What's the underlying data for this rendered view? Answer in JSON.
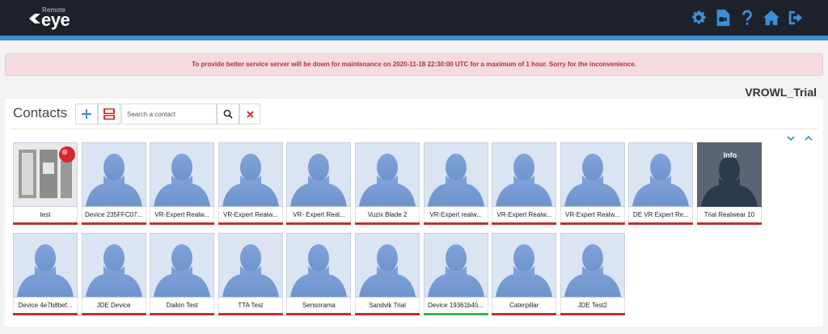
{
  "app": {
    "logo_small": "Remote",
    "logo_big": "eye"
  },
  "top_icons": [
    {
      "name": "gear-icon"
    },
    {
      "name": "video-file-icon"
    },
    {
      "name": "help-icon"
    },
    {
      "name": "home-icon"
    },
    {
      "name": "logout-icon"
    }
  ],
  "alert": {
    "message": "To provide better service server will be down for maintenance on 2020-11-18 22:30:00 UTC for a maximum of 1 hour. Sorry for the inconvenience."
  },
  "account": {
    "name": "VROWL_Trial"
  },
  "contacts": {
    "title": "Contacts",
    "search_placeholder": "Search a contact",
    "add_icon": "plus-icon",
    "youtube_icon": "youtube-icon",
    "search_icon": "search-icon",
    "clear_icon": "close-icon",
    "info_label": "Info",
    "items": [
      {
        "label": "test",
        "status": "offline",
        "avatar": "custom-logo"
      },
      {
        "label": "Device 235FFC07...",
        "status": "offline",
        "avatar": "default"
      },
      {
        "label": "VR-Expert Realw...",
        "status": "offline",
        "avatar": "default"
      },
      {
        "label": "VR-Expert Realw...",
        "status": "offline",
        "avatar": "default"
      },
      {
        "label": "VR- Expert Real...",
        "status": "offline",
        "avatar": "default"
      },
      {
        "label": "Vuzix Blade 2",
        "status": "offline",
        "avatar": "default"
      },
      {
        "label": "VR-Expert realw...",
        "status": "offline",
        "avatar": "default"
      },
      {
        "label": "VR-Expert Realw...",
        "status": "offline",
        "avatar": "default"
      },
      {
        "label": "VR-Expert Realw...",
        "status": "offline",
        "avatar": "default"
      },
      {
        "label": "DE VR Expert Re...",
        "status": "offline",
        "avatar": "default"
      },
      {
        "label": "Trial Realwear 10",
        "status": "offline",
        "avatar": "dark-info"
      },
      {
        "label": "Device 4e7b8bef...",
        "status": "offline",
        "avatar": "default"
      },
      {
        "label": "JDE Device",
        "status": "offline",
        "avatar": "default"
      },
      {
        "label": "Daikin Test",
        "status": "offline",
        "avatar": "default"
      },
      {
        "label": "TTA Test",
        "status": "offline",
        "avatar": "default"
      },
      {
        "label": "Sensorama",
        "status": "offline",
        "avatar": "default"
      },
      {
        "label": "Sandvik Trial",
        "status": "offline",
        "avatar": "default"
      },
      {
        "label": "Device 19361b45...",
        "status": "online",
        "avatar": "default"
      },
      {
        "label": "Caterpillar",
        "status": "offline",
        "avatar": "default"
      },
      {
        "label": "JDE Test2",
        "status": "offline",
        "avatar": "default"
      }
    ]
  },
  "colors": {
    "topbar": "#1d2129",
    "accent": "#3b8fd9",
    "offline": "#c0302f",
    "online": "#3bb54a",
    "alert_text": "#b12c3a"
  }
}
